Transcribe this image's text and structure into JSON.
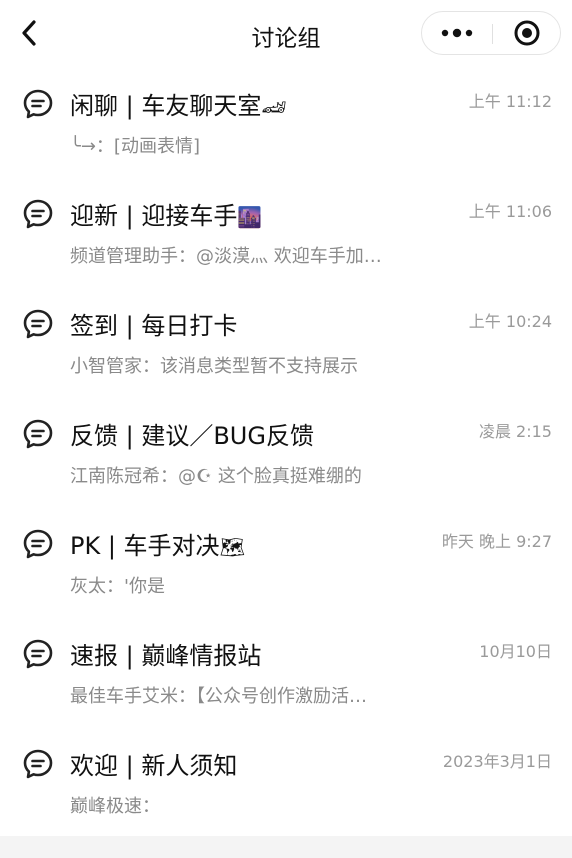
{
  "header": {
    "title": "讨论组",
    "back_icon": "chevron-left-icon",
    "more_icon": "more-dots-icon",
    "close_icon": "target-close-icon"
  },
  "channels": [
    {
      "name": "闲聊 | 车友聊天室",
      "emoji": "🏎",
      "time": "上午 11:12",
      "preview": "╰→：[动画表情]"
    },
    {
      "name": "迎新 | 迎接车手",
      "emoji": "🌆",
      "time": "上午 11:06",
      "preview": "频道管理助手：@淡漠灬 欢迎车手加…"
    },
    {
      "name": "签到 | 每日打卡",
      "emoji": "",
      "time": "上午 10:24",
      "preview": "小智管家：该消息类型暂不支持展示"
    },
    {
      "name": "反馈 | 建议／BUG反馈",
      "emoji": "",
      "time": "凌晨 2:15",
      "preview": "江南陈冠希：@☪ 这个脸真挺难绷的"
    },
    {
      "name": "PK | 车手对决",
      "emoji": "🗺",
      "time": "昨天 晚上 9:27",
      "preview": "灰太：'你是"
    },
    {
      "name": "速报 | 巅峰情报站",
      "emoji": "",
      "time": "10月10日",
      "preview": "最佳车手艾米：【公众号创作激励活…"
    },
    {
      "name": "欢迎 | 新人须知",
      "emoji": "",
      "time": "2023年3月1日",
      "preview": "巅峰极速："
    }
  ],
  "colors": {
    "text": "#111111",
    "muted": "#8a8a8a",
    "time": "#9a9a9a"
  }
}
